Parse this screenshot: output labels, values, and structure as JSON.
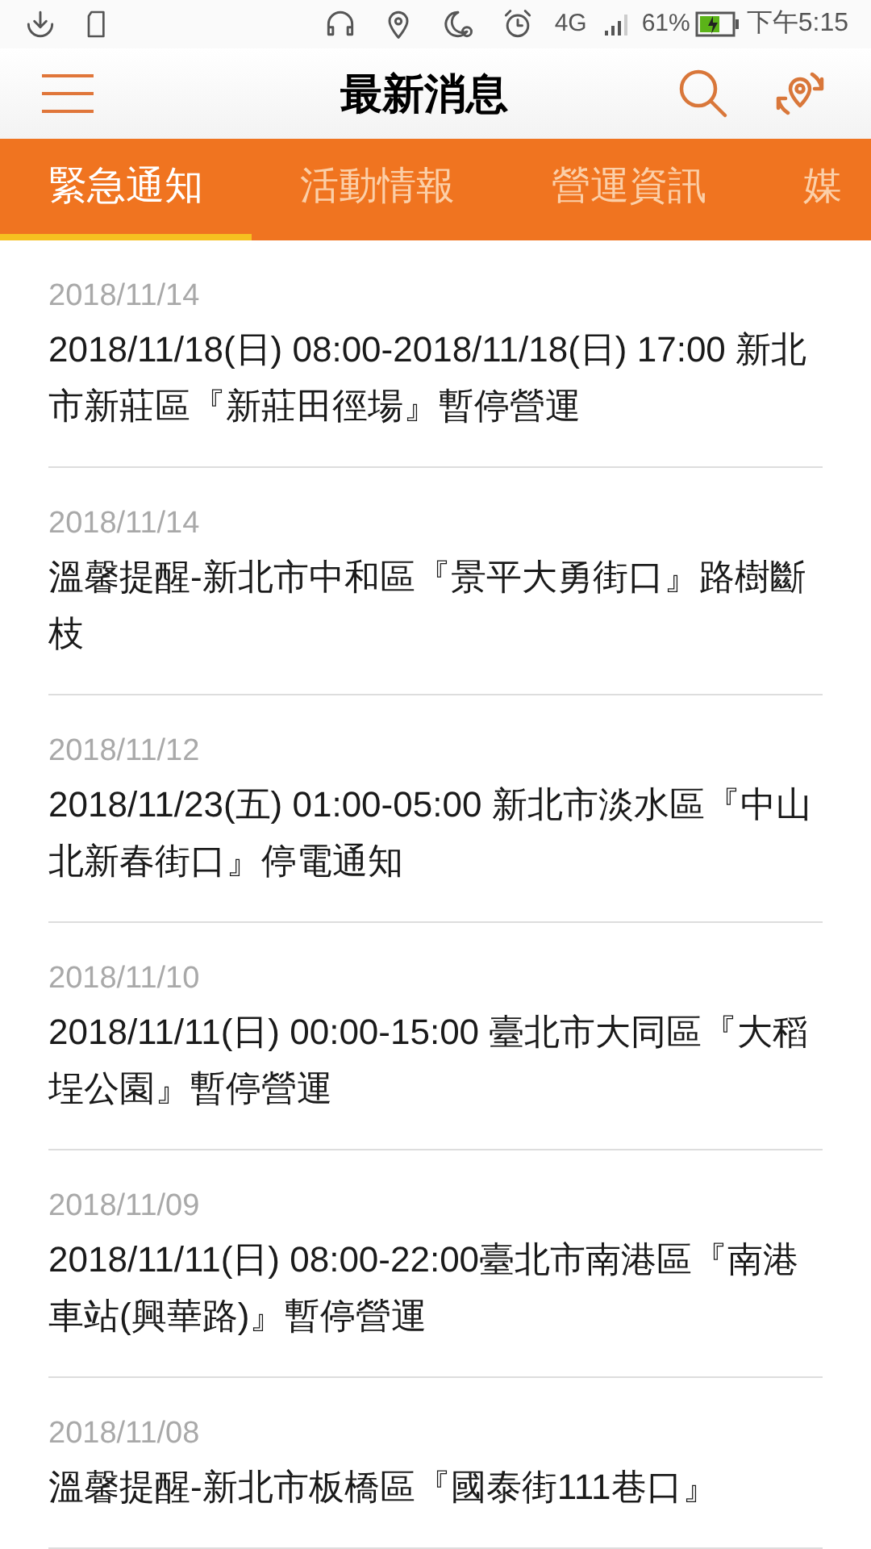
{
  "status_bar": {
    "network": "4G",
    "battery": "61%",
    "time": "下午5:15"
  },
  "header": {
    "title": "最新消息"
  },
  "tabs": [
    {
      "label": "緊急通知",
      "selected": true
    },
    {
      "label": "活動情報",
      "selected": false
    },
    {
      "label": "營運資訊",
      "selected": false
    },
    {
      "label": "媒",
      "selected": false
    }
  ],
  "news": [
    {
      "date": "2018/11/14",
      "title": "2018/11/18(日) 08:00-2018/11/18(日) 17:00 新北市新莊區『新莊田徑場』暫停營運"
    },
    {
      "date": "2018/11/14",
      "title": "溫馨提醒-新北市中和區『景平大勇街口』路樹斷枝"
    },
    {
      "date": "2018/11/12",
      "title": "2018/11/23(五) 01:00-05:00 新北市淡水區『中山北新春街口』停電通知"
    },
    {
      "date": "2018/11/10",
      "title": "2018/11/11(日) 00:00-15:00 臺北市大同區『大稻埕公園』暫停營運"
    },
    {
      "date": "2018/11/09",
      "title": "2018/11/11(日) 08:00-22:00臺北市南港區『南港車站(興華路)』暫停營運"
    },
    {
      "date": "2018/11/08",
      "title": "溫馨提醒-新北市板橋區『國泰街111巷口』"
    }
  ]
}
